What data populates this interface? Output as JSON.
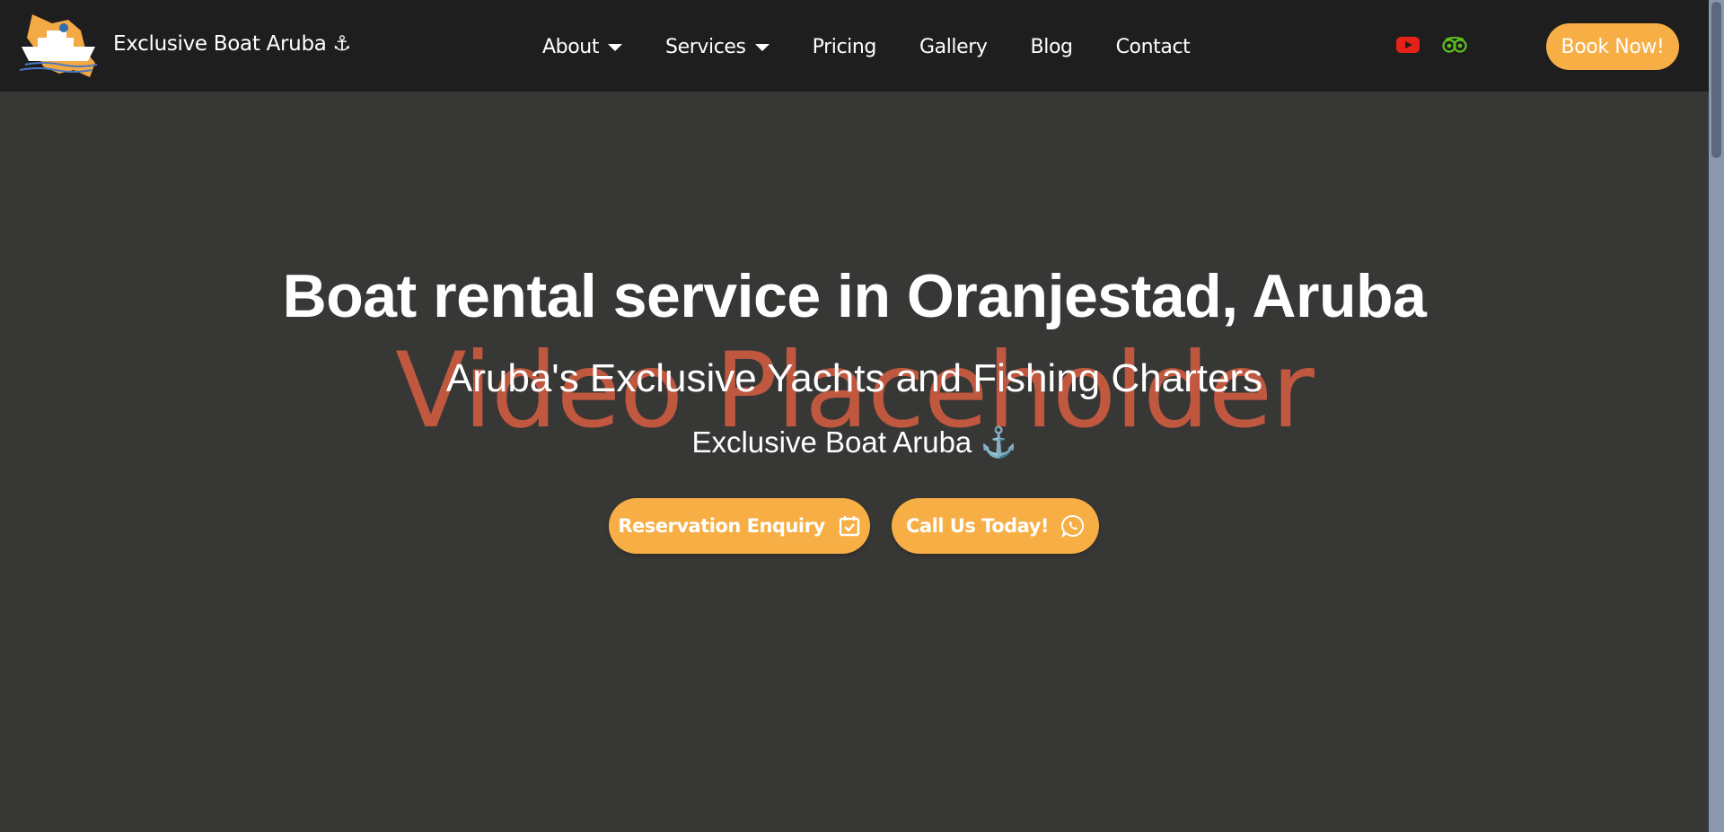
{
  "header": {
    "brand": "Exclusive Boat Aruba ⚓",
    "nav": [
      {
        "label": "About",
        "dropdown": true
      },
      {
        "label": "Services",
        "dropdown": true
      },
      {
        "label": "Pricing",
        "dropdown": false
      },
      {
        "label": "Gallery",
        "dropdown": false
      },
      {
        "label": "Blog",
        "dropdown": false
      },
      {
        "label": "Contact",
        "dropdown": false
      }
    ],
    "social": [
      "youtube-icon",
      "tripadvisor-icon"
    ],
    "book_label": "Book Now!"
  },
  "hero": {
    "placeholder": "Video Placeholder",
    "title": "Boat rental service in Oranjestad, Aruba",
    "subtitle": "Aruba's Exclusive Yachts and Fishing Charters",
    "brand": "Exclusive Boat Aruba ⚓",
    "buttons": [
      {
        "label": "Reservation Enquiry",
        "icon": "calendar-check-icon"
      },
      {
        "label": "Call Us Today!",
        "icon": "whatsapp-icon"
      }
    ]
  },
  "colors": {
    "accent": "#f7ae45",
    "header_bg": "#1e1e1e",
    "hero_bg": "#373735",
    "placeholder_text": "#c0583f",
    "youtube": "#e62117",
    "tripadvisor": "#34e0a1"
  }
}
